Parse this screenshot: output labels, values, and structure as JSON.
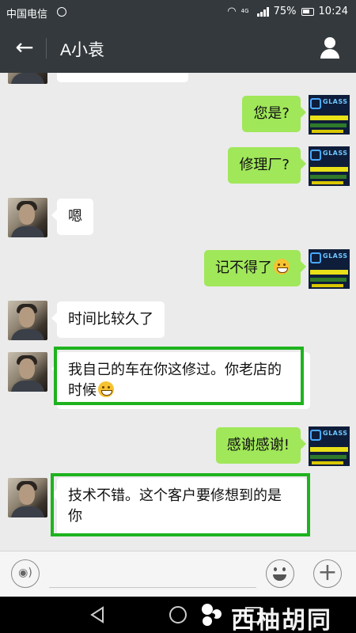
{
  "status_bar": {
    "carrier": "中国电信",
    "net_label": "4G",
    "battery": "75%",
    "time": "10:24"
  },
  "header": {
    "title": "A小袁"
  },
  "messages": [
    {
      "side": "right",
      "text": "您是?"
    },
    {
      "side": "right",
      "text": "修理厂?"
    },
    {
      "side": "left",
      "text": "嗯"
    },
    {
      "side": "right",
      "text": "记不得了"
    },
    {
      "side": "left",
      "text": "时间比较久了"
    },
    {
      "side": "left",
      "text_line1": "我自己的车在你这修过。你老店的",
      "text_line2": "时候",
      "highlighted": true
    },
    {
      "side": "right",
      "text": "感谢感谢!"
    },
    {
      "side": "left",
      "text_line1": "技术不错。这个客户要修想到的是",
      "text_line2": "你",
      "highlighted": true
    }
  ],
  "avatar_right_brand": "GLASS",
  "colors": {
    "header_bg": "#34393d",
    "chat_bg": "#ebebeb",
    "bubble_right": "#a0e75a",
    "bubble_left": "#ffffff",
    "highlight_border": "#1eb31e"
  },
  "watermark": {
    "text": "西柚胡同"
  },
  "icons": [
    "back-arrow-icon",
    "profile-icon",
    "voice-icon",
    "emoji-icon",
    "plus-icon",
    "nav-back-icon",
    "nav-home-icon",
    "nav-recent-icon"
  ]
}
